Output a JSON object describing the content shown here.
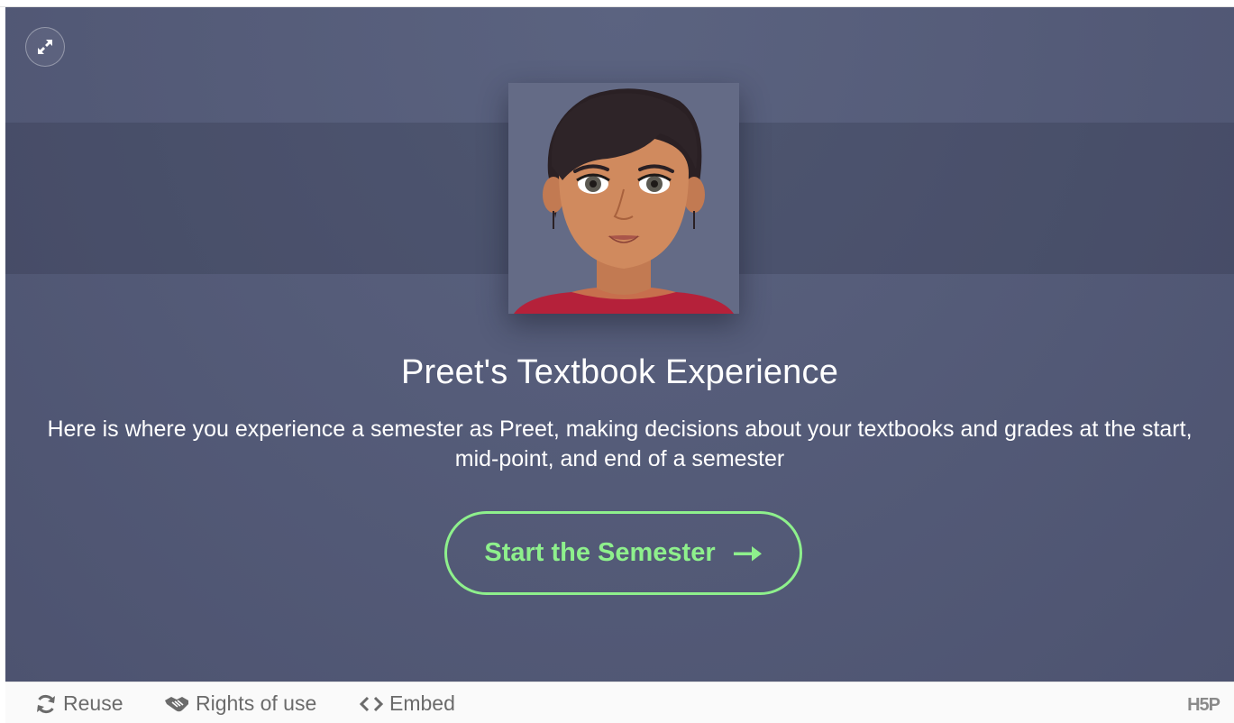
{
  "app": {
    "title": "Preet's Textbook Experience",
    "description": "Here is where you experience a semester as Preet, making decisions about your textbooks and grades at the start, mid-point, and end of a semester",
    "start_button_label": "Start the Semester",
    "accent_color": "#8ef08c",
    "background_color": "#555c79"
  },
  "icons": {
    "fullscreen": "expand-icon",
    "start_arrow": "arrow-right-icon",
    "reuse": "refresh-icon",
    "rights": "handshake-icon",
    "embed": "code-icon"
  },
  "footer": {
    "reuse_label": "Reuse",
    "rights_label": "Rights of use",
    "embed_label": "Embed",
    "logo": "H5P"
  }
}
